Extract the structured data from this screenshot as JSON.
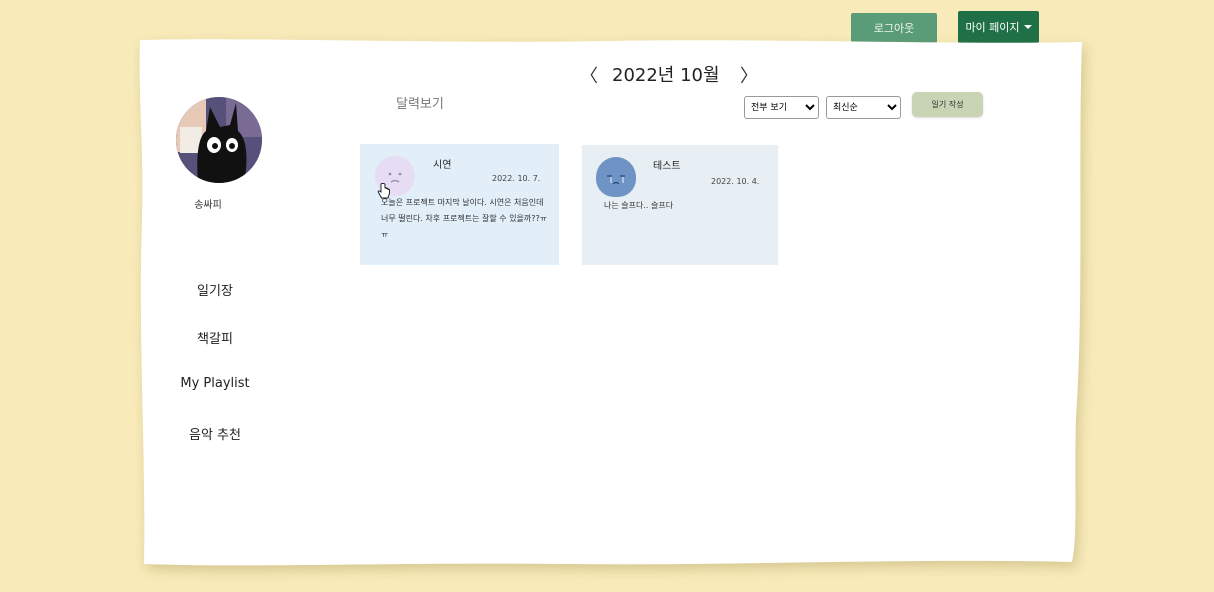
{
  "header": {
    "logout_label": "로그아웃",
    "mypage_label": "마이 페이지"
  },
  "sidebar": {
    "nickname": "송싸피",
    "items": [
      {
        "label": "일기장"
      },
      {
        "label": "책갈피"
      },
      {
        "label": "My Playlist"
      },
      {
        "label": "음악 추천"
      }
    ]
  },
  "main": {
    "month_title": "2022년 10월",
    "prev_label": "〈",
    "next_label": "〉",
    "calendar_view_label": "달력보기",
    "filter_selected": "전부 보기",
    "sort_selected": "최신순",
    "write_label": "일기 작성",
    "diaries": [
      {
        "title": "시연",
        "date": "2022. 10. 7.",
        "body": "오늘은 프로젝트 마지막 날이다. 시연은 처음인데 너무 떨린다. 차후 프로젝트는 잘할 수 있을까??ㅠㅠ",
        "emotion": "sad-pale-icon"
      },
      {
        "title": "테스트",
        "date": "2022. 10. 4.",
        "body": "나는 슬프다.. 슬프다",
        "emotion": "crying-blue-icon"
      }
    ]
  },
  "colors": {
    "background": "#f8ebb9",
    "logout": "#5a9c78",
    "mypage": "#1f7046",
    "write": "#c8d4b4"
  }
}
